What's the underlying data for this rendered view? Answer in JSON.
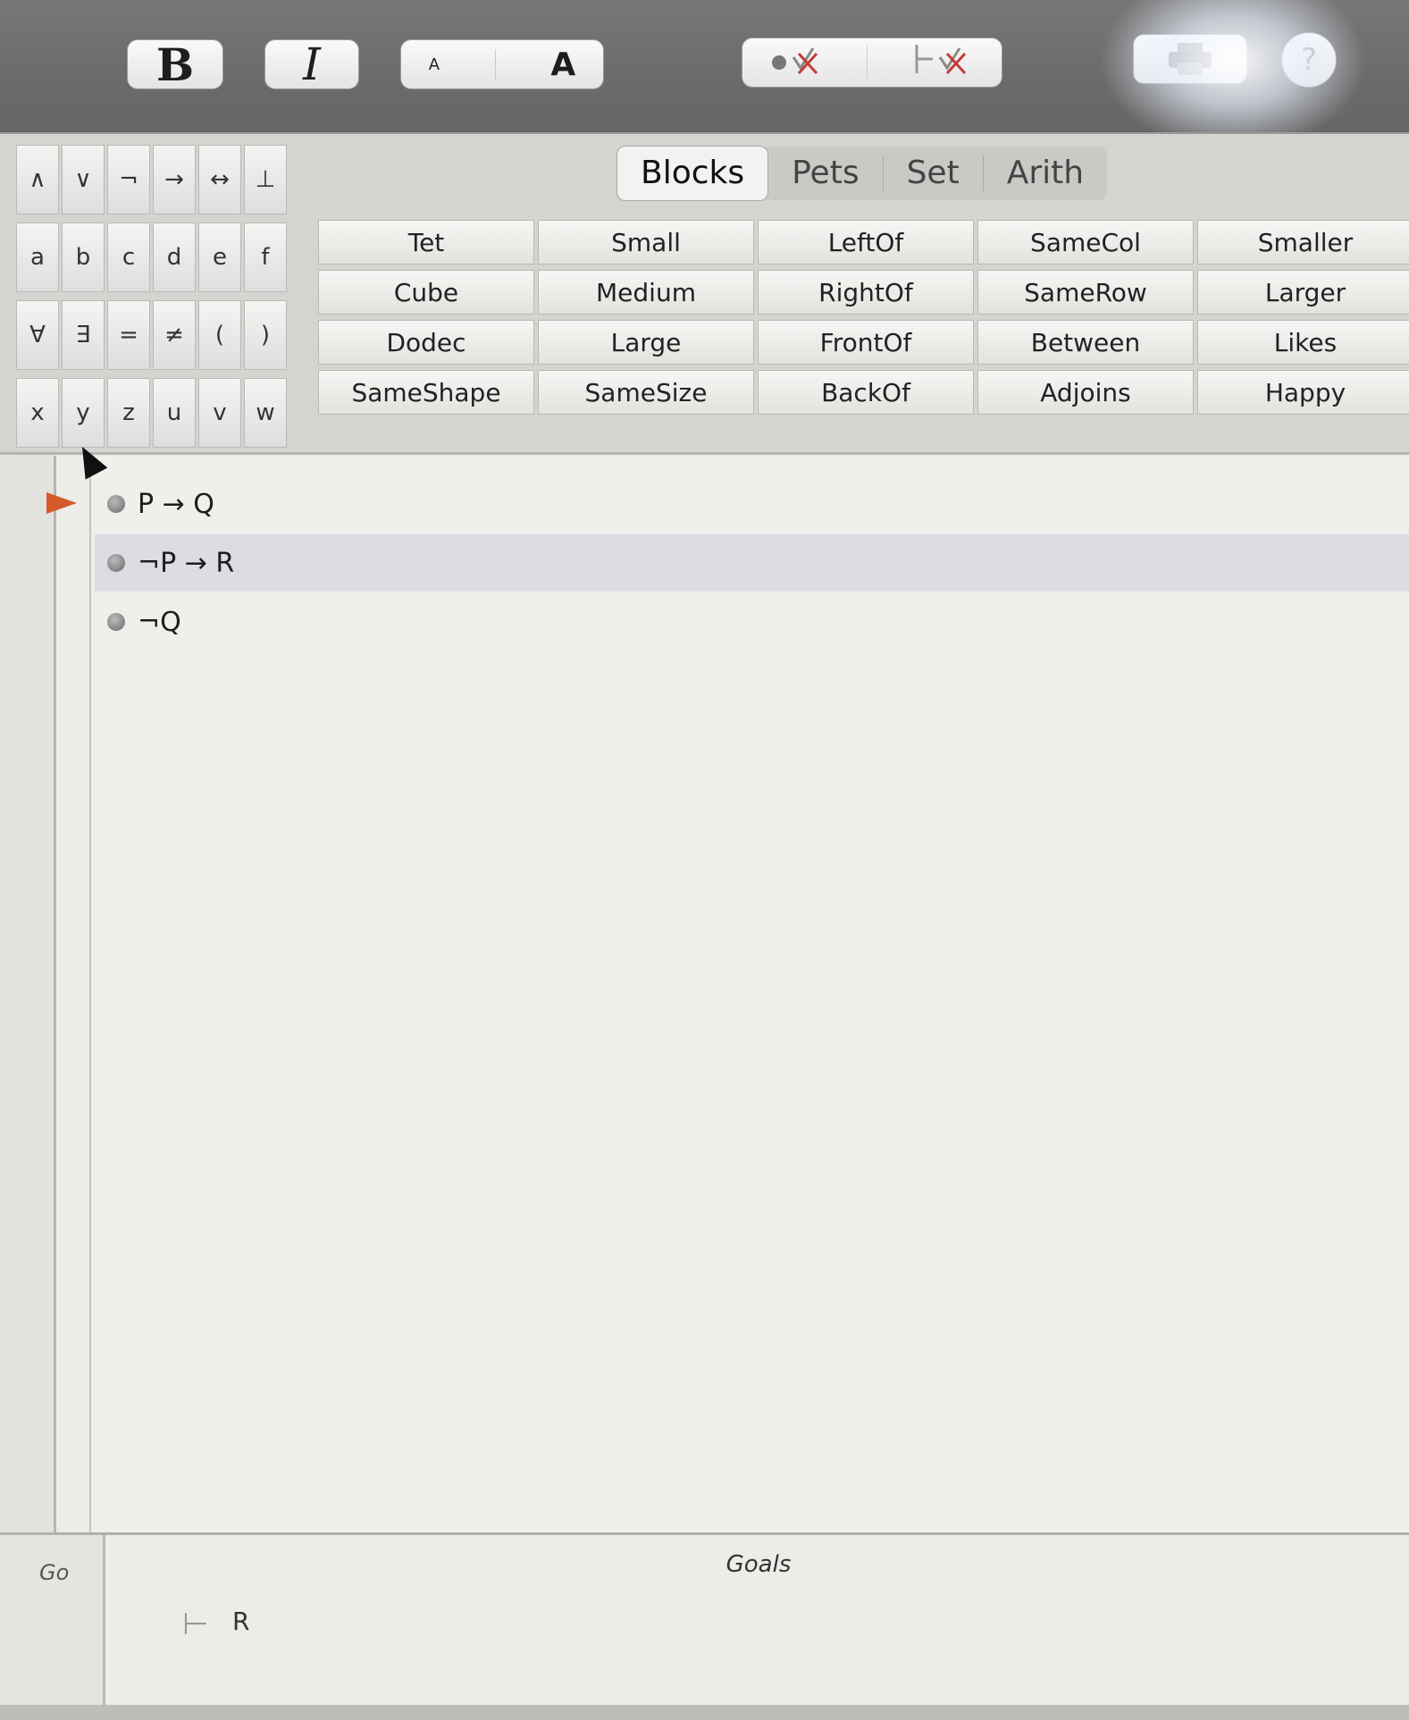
{
  "toolbar": {
    "bold_label": "B",
    "italic_label": "I",
    "font_smaller": "A",
    "font_larger": "A",
    "help_label": "?"
  },
  "palette": {
    "connectives": [
      "∧",
      "∨",
      "¬",
      "→",
      "↔",
      "⊥"
    ],
    "constants": [
      "a",
      "b",
      "c",
      "d",
      "e",
      "f"
    ],
    "quantifiers": [
      "∀",
      "∃",
      "=",
      "≠",
      "(",
      ")"
    ],
    "variables": [
      "x",
      "y",
      "z",
      "u",
      "v",
      "w"
    ],
    "tabs": [
      {
        "label": "Blocks",
        "active": true
      },
      {
        "label": "Pets",
        "active": false
      },
      {
        "label": "Set",
        "active": false
      },
      {
        "label": "Arith",
        "active": false
      }
    ],
    "predicates": [
      "Tet",
      "Small",
      "LeftOf",
      "SameCol",
      "Smaller",
      "Cube",
      "Medium",
      "RightOf",
      "SameRow",
      "Larger",
      "Dodec",
      "Large",
      "FrontOf",
      "Between",
      "Likes",
      "SameShape",
      "SameSize",
      "BackOf",
      "Adjoins",
      "Happy"
    ]
  },
  "proof": {
    "premises": [
      "P → Q",
      "¬P → R",
      "¬Q"
    ],
    "selected_index": 1
  },
  "goals": {
    "side_label": "Go",
    "title": "Goals",
    "turnstile": "⊢",
    "goal": "R"
  },
  "colors": {
    "toolbar": "#6e6e6e",
    "focus_arrow": "#d55a2a",
    "selected_row": "#dcdce2"
  }
}
